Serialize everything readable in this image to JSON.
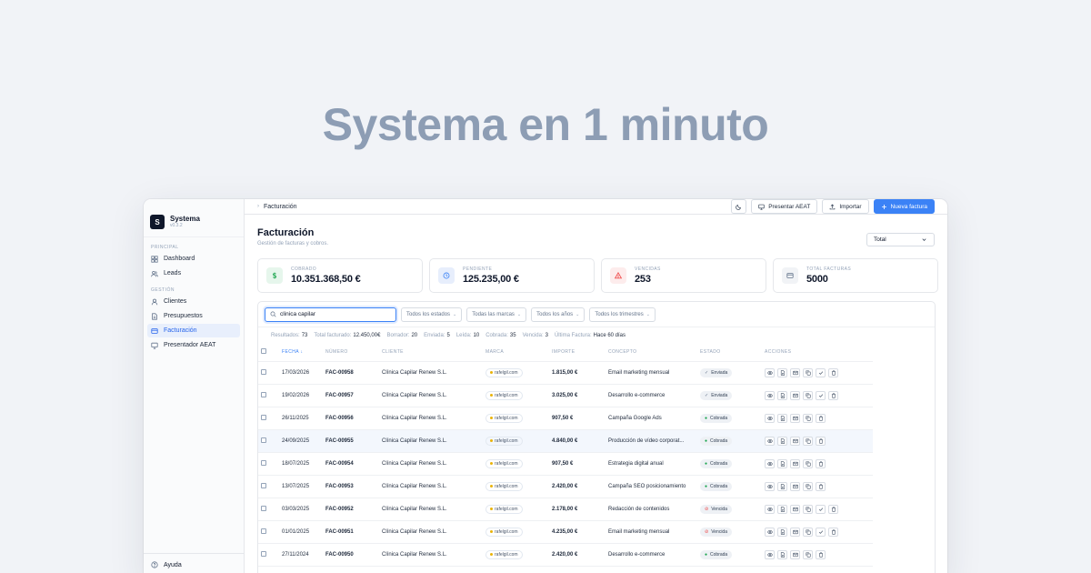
{
  "hero_title": "Systema en 1 minuto",
  "app": {
    "name": "Systema",
    "version": "v0.3.2"
  },
  "sidebar": {
    "sections": [
      {
        "label": "PRINCIPAL",
        "items": [
          {
            "label": "Dashboard",
            "icon": "grid-icon"
          },
          {
            "label": "Leads",
            "icon": "users-icon"
          }
        ]
      },
      {
        "label": "GESTIÓN",
        "items": [
          {
            "label": "Clientes",
            "icon": "user-icon"
          },
          {
            "label": "Presupuestos",
            "icon": "document-icon"
          },
          {
            "label": "Facturación",
            "icon": "card-icon",
            "active": true
          },
          {
            "label": "Presentador AEAT",
            "icon": "monitor-icon"
          }
        ]
      }
    ],
    "help_label": "Ayuda"
  },
  "breadcrumb": "Facturación",
  "toolbar": {
    "theme_icon": "moon-icon",
    "present_label": "Presentar AEAT",
    "import_label": "Importar",
    "new_invoice_label": "Nueva factura"
  },
  "page": {
    "title": "Facturación",
    "subtitle": "Gestión de facturas y cobros.",
    "period_filter": "Total"
  },
  "stats": [
    {
      "label": "COBRADO",
      "value": "10.351.368,50 €",
      "icon": "dollar-icon",
      "bg": "#e6f6ec",
      "fg": "#16a34a"
    },
    {
      "label": "PENDIENTE",
      "value": "125.235,00 €",
      "icon": "clock-icon",
      "bg": "#e7eefc",
      "fg": "#3b82f6"
    },
    {
      "label": "VENCIDAS",
      "value": "253",
      "icon": "warning-icon",
      "bg": "#fdecec",
      "fg": "#ef4444"
    },
    {
      "label": "TOTAL FACTURAS",
      "value": "5000",
      "icon": "card-icon",
      "bg": "#f1f3f6",
      "fg": "#64748b"
    }
  ],
  "search": {
    "value": "clinica capilar"
  },
  "filters": [
    "Todos los estados",
    "Todas las marcas",
    "Todos los años",
    "Todos los trimestres"
  ],
  "summary": {
    "results_label": "Resultados:",
    "results": "73",
    "billed_label": "Total facturado:",
    "billed": "12.450,00€",
    "draft_label": "Borrador:",
    "draft": "20",
    "sent_label": "Enviada:",
    "sent": "5",
    "read_label": "Leída:",
    "read": "10",
    "paid_label": "Cobrada:",
    "paid": "35",
    "overdue_label": "Vencida:",
    "overdue": "3",
    "last_label": "Última Factura:",
    "last": "Hace 60 días"
  },
  "table": {
    "columns": [
      "FECHA",
      "NÚMERO",
      "CLIENTE",
      "MARCA",
      "IMPORTE",
      "CONCEPTO",
      "ESTADO",
      "ACCIONES"
    ],
    "rows": [
      {
        "fecha": "17/03/2026",
        "numero": "FAC-00958",
        "cliente": "Clínica Capilar Renew S.L.",
        "marca": "rafelgil.com",
        "importe": "1.815,00 €",
        "concepto": "Email marketing mensual",
        "estado": "Enviada",
        "status_icon": "✓",
        "status_color": "#64748b",
        "actions": 6
      },
      {
        "fecha": "19/02/2026",
        "numero": "FAC-00957",
        "cliente": "Clínica Capilar Renew S.L.",
        "marca": "rafelgil.com",
        "importe": "3.025,00 €",
        "concepto": "Desarrollo e-commerce",
        "estado": "Enviada",
        "status_icon": "✓",
        "status_color": "#64748b",
        "actions": 6
      },
      {
        "fecha": "26/11/2025",
        "numero": "FAC-00956",
        "cliente": "Clínica Capilar Renew S.L.",
        "marca": "rafelgil.com",
        "importe": "907,50 €",
        "concepto": "Campaña Google Ads",
        "estado": "Cobrada",
        "status_icon": "●",
        "status_color": "#16a34a",
        "actions": 5
      },
      {
        "fecha": "24/09/2025",
        "numero": "FAC-00955",
        "cliente": "Clínica Capilar Renew S.L.",
        "marca": "rafelgil.com",
        "importe": "4.840,00 €",
        "concepto": "Producción de vídeo corporat...",
        "estado": "Cobrada",
        "status_icon": "●",
        "status_color": "#16a34a",
        "actions": 5,
        "highlight": true
      },
      {
        "fecha": "18/07/2025",
        "numero": "FAC-00954",
        "cliente": "Clínica Capilar Renew S.L.",
        "marca": "rafelgil.com",
        "importe": "907,50 €",
        "concepto": "Estrategia digital anual",
        "estado": "Cobrada",
        "status_icon": "●",
        "status_color": "#16a34a",
        "actions": 5
      },
      {
        "fecha": "13/07/2025",
        "numero": "FAC-00953",
        "cliente": "Clínica Capilar Renew S.L.",
        "marca": "rafelgil.com",
        "importe": "2.420,00 €",
        "concepto": "Campaña SEO posicionamiento",
        "estado": "Cobrada",
        "status_icon": "●",
        "status_color": "#16a34a",
        "actions": 5
      },
      {
        "fecha": "03/03/2025",
        "numero": "FAC-00952",
        "cliente": "Clínica Capilar Renew S.L.",
        "marca": "rafelgil.com",
        "importe": "2.178,00 €",
        "concepto": "Redacción de contenidos",
        "estado": "Vencida",
        "status_icon": "⊘",
        "status_color": "#ef4444",
        "actions": 6
      },
      {
        "fecha": "01/01/2025",
        "numero": "FAC-00951",
        "cliente": "Clínica Capilar Renew S.L.",
        "marca": "rafelgil.com",
        "importe": "4.235,00 €",
        "concepto": "Email marketing mensual",
        "estado": "Vencida",
        "status_icon": "⊘",
        "status_color": "#ef4444",
        "actions": 6
      },
      {
        "fecha": "27/11/2024",
        "numero": "FAC-00950",
        "cliente": "Clínica Capilar Renew S.L.",
        "marca": "rafelgil.com",
        "importe": "2.420,00 €",
        "concepto": "Desarrollo e-commerce",
        "estado": "Cobrada",
        "status_icon": "●",
        "status_color": "#16a34a",
        "actions": 5
      }
    ]
  }
}
